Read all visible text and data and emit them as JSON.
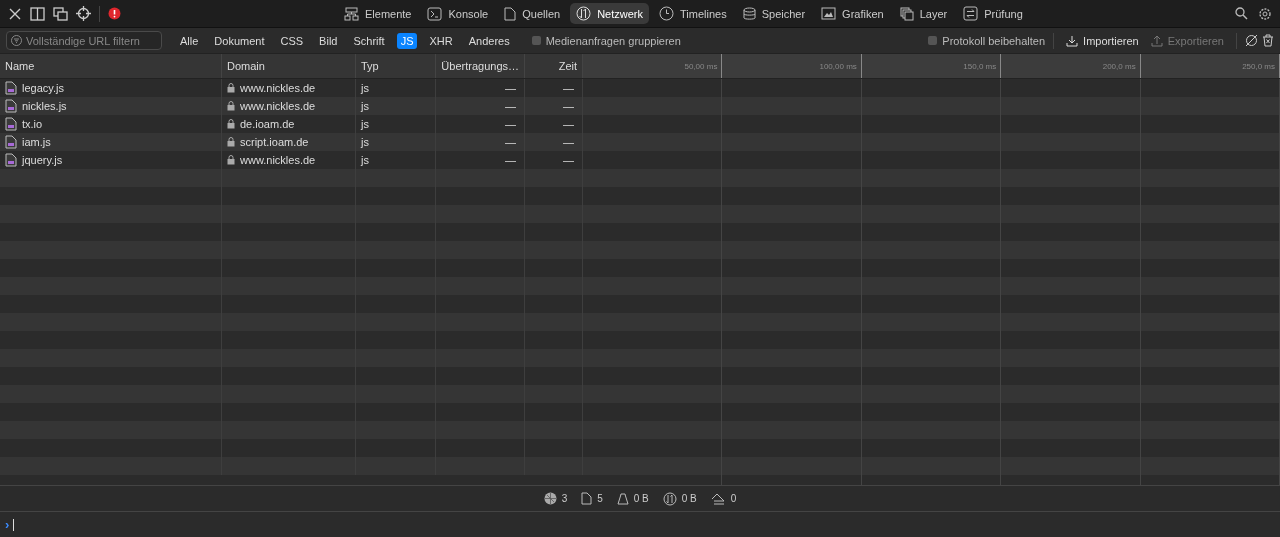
{
  "tabs": [
    {
      "label": "Elemente",
      "kind": "elements",
      "selected": false
    },
    {
      "label": "Konsole",
      "kind": "console",
      "selected": false
    },
    {
      "label": "Quellen",
      "kind": "sources",
      "selected": false
    },
    {
      "label": "Netzwerk",
      "kind": "network",
      "selected": true
    },
    {
      "label": "Timelines",
      "kind": "timelines",
      "selected": false
    },
    {
      "label": "Speicher",
      "kind": "storage",
      "selected": false
    },
    {
      "label": "Grafiken",
      "kind": "graphics",
      "selected": false
    },
    {
      "label": "Layer",
      "kind": "layers",
      "selected": false
    },
    {
      "label": "Prüfung",
      "kind": "audit",
      "selected": false
    }
  ],
  "filter": {
    "placeholder": "Vollständige URL filtern"
  },
  "types": [
    {
      "label": "Alle",
      "selected": false
    },
    {
      "label": "Dokument",
      "selected": false
    },
    {
      "label": "CSS",
      "selected": false
    },
    {
      "label": "Bild",
      "selected": false
    },
    {
      "label": "Schrift",
      "selected": false
    },
    {
      "label": "JS",
      "selected": true
    },
    {
      "label": "XHR",
      "selected": false
    },
    {
      "label": "Anderes",
      "selected": false
    }
  ],
  "group_media": {
    "label": "Medienanfragen gruppieren",
    "checked": false
  },
  "preserve_log": {
    "label": "Protokoll beibehalten",
    "checked": false
  },
  "import_button": {
    "label": "Importieren",
    "disabled": false
  },
  "export_button": {
    "label": "Exportieren",
    "disabled": true
  },
  "table": {
    "columns": [
      "Name",
      "Domain",
      "Typ",
      "Übertragungs…",
      "Zeit"
    ],
    "ticks": [
      "50,00 ms",
      "100,00 ms",
      "150,0 ms",
      "200,0 ms",
      "250,0 ms"
    ],
    "rows": [
      {
        "name": "legacy.js",
        "domain": "www.nickles.de",
        "type": "js",
        "transfer": "—",
        "time": "—"
      },
      {
        "name": "nickles.js",
        "domain": "www.nickles.de",
        "type": "js",
        "transfer": "—",
        "time": "—"
      },
      {
        "name": "tx.io",
        "domain": "de.ioam.de",
        "type": "js",
        "transfer": "—",
        "time": "—"
      },
      {
        "name": "iam.js",
        "domain": "script.ioam.de",
        "type": "js",
        "transfer": "—",
        "time": "—"
      },
      {
        "name": "jquery.js",
        "domain": "www.nickles.de",
        "type": "js",
        "transfer": "—",
        "time": "—"
      }
    ]
  },
  "status": [
    {
      "kind": "domains",
      "value": "3"
    },
    {
      "kind": "resources",
      "value": "5"
    },
    {
      "kind": "size",
      "value": "0 B"
    },
    {
      "kind": "transferred",
      "value": "0 B"
    },
    {
      "kind": "redirects",
      "value": "0"
    }
  ],
  "console": {
    "prompt": "›"
  }
}
